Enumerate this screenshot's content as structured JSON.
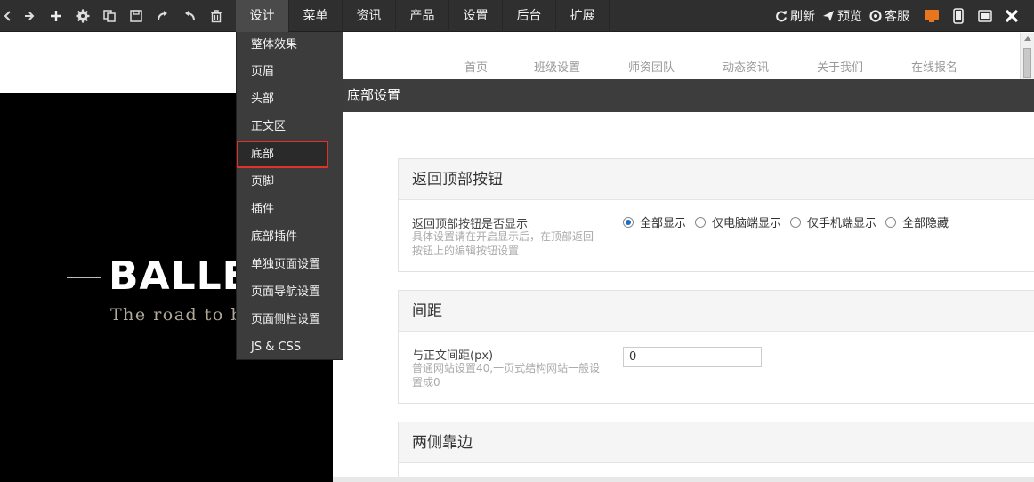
{
  "toolbar": {
    "icons": [
      "back-icon",
      "forward-icon",
      "add-icon",
      "settings-icon",
      "copy-icon",
      "save-icon",
      "redo-icon",
      "undo-icon",
      "delete-icon"
    ],
    "menu_tabs": [
      {
        "label": "设计",
        "active": true
      },
      {
        "label": "菜单",
        "active": false
      },
      {
        "label": "资讯",
        "active": false
      },
      {
        "label": "产品",
        "active": false
      },
      {
        "label": "设置",
        "active": false
      },
      {
        "label": "后台",
        "active": false
      },
      {
        "label": "扩展",
        "active": false
      }
    ],
    "refresh_label": "刷新",
    "preview_label": "预览",
    "service_label": "客服",
    "accent_color": "#e8761e"
  },
  "design_menu": {
    "items": [
      {
        "label": "整体效果"
      },
      {
        "label": "页眉"
      },
      {
        "label": "头部"
      },
      {
        "label": "正文区"
      },
      {
        "label": "底部",
        "selected": true
      },
      {
        "label": "页脚"
      },
      {
        "label": "插件"
      },
      {
        "label": "底部插件"
      },
      {
        "label": "单独页面设置"
      },
      {
        "label": "页面导航设置"
      },
      {
        "label": "页面侧栏设置"
      },
      {
        "label": "JS & CSS"
      }
    ]
  },
  "site_preview": {
    "nav": [
      "首页",
      "班级设置",
      "师资团队",
      "动态资讯",
      "关于我们",
      "在线报名"
    ],
    "hero_title": "BALLE",
    "hero_subtitle": "The road to b"
  },
  "panel": {
    "title": "底部设置",
    "sections": {
      "back_to_top": {
        "title": "返回顶部按钮",
        "field_label": "返回顶部按钮是否显示",
        "help": "具体设置请在开启显示后，在顶部返回按钮上的编辑按钮设置",
        "options": [
          {
            "label": "全部显示",
            "checked": true
          },
          {
            "label": "仅电脑端显示",
            "checked": false
          },
          {
            "label": "仅手机端显示",
            "checked": false
          },
          {
            "label": "全部隐藏",
            "checked": false
          }
        ]
      },
      "spacing": {
        "title": "间距",
        "field_label": "与正文间距(px)",
        "help": "普通网站设置40,一页式结构网站一般设置成0",
        "value": "0"
      },
      "edges": {
        "title": "两侧靠边"
      }
    }
  }
}
